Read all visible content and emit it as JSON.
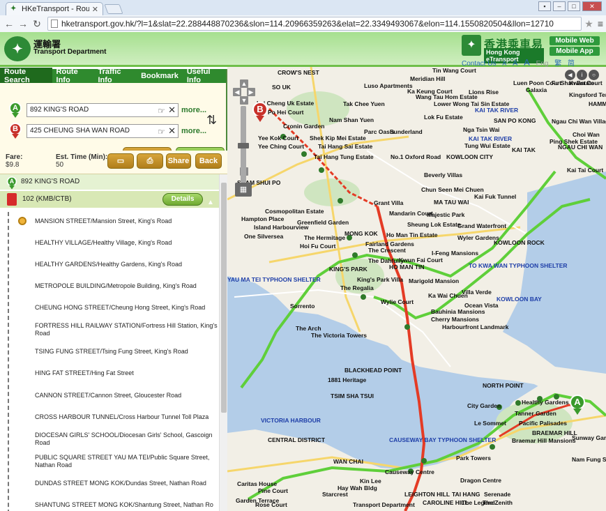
{
  "browser": {
    "tab_title": "HKeTransport - Route Se",
    "url": "hketransport.gov.hk/?l=1&slat=22.288448870236&slon=114.20966359263&elat=22.3349493067&elon=114.1550820504&llon=12710"
  },
  "header": {
    "dept_cn": "運輸署",
    "dept_en": "Transport Department",
    "brand_cn": "香港乘車易",
    "brand_en": "Hong Kong eTransport",
    "mobile_web": "Mobile Web",
    "mobile_app": "Mobile App",
    "contact": "Contact Us",
    "font_small": "A",
    "font_mid": "A",
    "font_large": "A",
    "lang_en": "Eng",
    "lang_tc": "繁",
    "lang_sc": "简"
  },
  "panel": {
    "tabs": [
      "Route Search",
      "Route Info",
      "Traffic Info",
      "Bookmark",
      "Useful Info"
    ],
    "origin": "892 KING'S ROAD",
    "destination": "425 CHEUNG SHA WAN ROAD",
    "more": "more...",
    "reset": "Reset",
    "search": "Search",
    "fare_label": "Fare:",
    "fare_value": "$9.8",
    "time_label": "Est. Time (Min):",
    "time_value": "50",
    "share": "Share",
    "back": "Back",
    "from_stop": "892 KING'S ROAD",
    "route": "102 (KMB/CTB)",
    "details": "Details",
    "stops": [
      "MANSION STREET/Mansion Street, King's Road",
      "HEALTHY VILLAGE/Healthy Village, King's Road",
      "HEALTHY GARDENS/Healthy Gardens, King's Road",
      "METROPOLE BUILDING/Metropole Building, King's Road",
      "CHEUNG HONG STREET/Cheung Hong Street, King's Road",
      "FORTRESS HILL RAILWAY STATION/Fortress Hill Station, King's Road",
      "TSING FUNG STREET/Tsing Fung Street, King's Road",
      "HING FAT STREET/Hing Fat Street",
      "CANNON STREET/Cannon Street, Gloucester Road",
      "CROSS HARBOUR TUNNEL/Cross Harbour Tunnel Toll Plaza",
      "DIOCESAN GIRLS' SCHOOL/Diocesan Girls' School, Gascoign Road",
      "PUBLIC SQUARE STREET YAU MA TEI/Public Square Street, Nathan Road",
      "DUNDAS STREET MONG KOK/Dundas Street, Nathan Road",
      "SHANTUNG STREET MONG KOK/Shantung Street, Nathan Ro"
    ]
  },
  "map": {
    "pin_a": "A",
    "pin_b": "B",
    "labels": [
      {
        "t": "CROW'S NEST",
        "c": "dark"
      },
      {
        "t": "Meridian Hill",
        "c": "dark"
      },
      {
        "t": "Tin Wang Court",
        "c": "dark"
      },
      {
        "t": "SO UK",
        "c": "dark"
      },
      {
        "t": "Luso Apartments",
        "c": "dark"
      },
      {
        "t": "Ka Keung Court",
        "c": "dark"
      },
      {
        "t": "Wang Tau Hom Estate",
        "c": "dark"
      },
      {
        "t": "Lok Fu Estate",
        "c": "dark"
      },
      {
        "t": "Lower Wong Tai Sin Estate",
        "c": "dark"
      },
      {
        "t": "Luen Poon Court",
        "c": "dark"
      },
      {
        "t": "Lions Rise",
        "c": "dark"
      },
      {
        "t": "Galaxia",
        "c": "dark"
      },
      {
        "t": "Fu Shan Estate",
        "c": "dark"
      },
      {
        "t": "Kwan Court",
        "c": "dark"
      },
      {
        "t": "Kingsford Terrace",
        "c": "dark"
      },
      {
        "t": "HAMMER HILL",
        "c": "dark"
      },
      {
        "t": "Lei Cheng Uk Estate",
        "c": "dark"
      },
      {
        "t": "Tak Chee Yuen",
        "c": "dark"
      },
      {
        "t": "Po Hei Court",
        "c": "dark"
      },
      {
        "t": "KAI TAK RIVER",
        "c": "blue"
      },
      {
        "t": "Nam Shan Yuen",
        "c": "dark"
      },
      {
        "t": "Cronin Garden",
        "c": "dark"
      },
      {
        "t": "Parc Oasis",
        "c": "dark"
      },
      {
        "t": "Sunderland",
        "c": "dark"
      },
      {
        "t": "SAN PO KONG",
        "c": "dark"
      },
      {
        "t": "Ngau Chi Wan Village",
        "c": "dark"
      },
      {
        "t": "Nga Tsin Wai",
        "c": "dark"
      },
      {
        "t": "Yee Kok Court",
        "c": "dark"
      },
      {
        "t": "Shek Kip Mei Estate",
        "c": "dark"
      },
      {
        "t": "Yee Ching Court",
        "c": "dark"
      },
      {
        "t": "Tai Hang Sai Estate",
        "c": "dark"
      },
      {
        "t": "KAI TAK RIVER",
        "c": "blue"
      },
      {
        "t": "Tung Wui Estate",
        "c": "dark"
      },
      {
        "t": "KAI TAK",
        "c": "dark"
      },
      {
        "t": "Choi Wan",
        "c": "dark"
      },
      {
        "t": "Ping Shek Estate",
        "c": "dark"
      },
      {
        "t": "NGAU CHI WAN",
        "c": "dark"
      },
      {
        "t": "Tai Hang Tung Estate",
        "c": "dark"
      },
      {
        "t": "No.1 Oxford Road",
        "c": "dark"
      },
      {
        "t": "KOWLOON CITY",
        "c": "dark"
      },
      {
        "t": "Kai Tai Court",
        "c": "dark"
      },
      {
        "t": "Beverly Villas",
        "c": "dark"
      },
      {
        "t": "SHAM SHUI PO",
        "c": "dark"
      },
      {
        "t": "Chun Seen Mei Chuen",
        "c": "dark"
      },
      {
        "t": "MA TAU WAI",
        "c": "dark"
      },
      {
        "t": "Kai Fuk Tunnel",
        "c": "dark"
      },
      {
        "t": "Grant Villa",
        "c": "dark"
      },
      {
        "t": "Cosmopolitan Estate",
        "c": "dark"
      },
      {
        "t": "Hampton Place",
        "c": "dark"
      },
      {
        "t": "Greenfield Garden",
        "c": "dark"
      },
      {
        "t": "Mandarin Court",
        "c": "dark"
      },
      {
        "t": "Majestic Park",
        "c": "dark"
      },
      {
        "t": "Sheung Lok Estate",
        "c": "dark"
      },
      {
        "t": "Island Harbourview",
        "c": "dark"
      },
      {
        "t": "Grand Waterfront",
        "c": "dark"
      },
      {
        "t": "One Silversea",
        "c": "dark"
      },
      {
        "t": "MONG KOK",
        "c": "dark"
      },
      {
        "t": "Ho Man Tin Estate",
        "c": "dark"
      },
      {
        "t": "The Hermitage",
        "c": "dark"
      },
      {
        "t": "Wyler Gardens",
        "c": "dark"
      },
      {
        "t": "Fairland Gardens",
        "c": "dark"
      },
      {
        "t": "Hoi Fu Court",
        "c": "dark"
      },
      {
        "t": "The Crescent",
        "c": "dark"
      },
      {
        "t": "KOWLOON ROCK",
        "c": "dark"
      },
      {
        "t": "I-Feng Mansions",
        "c": "dark"
      },
      {
        "t": "The Dahfully",
        "c": "dark"
      },
      {
        "t": "Kwun Fai Court",
        "c": "dark"
      },
      {
        "t": "TO KWA WAN TYPHOON SHELTER",
        "c": "blue"
      },
      {
        "t": "KING'S PARK",
        "c": "dark"
      },
      {
        "t": "HO MAN TIN",
        "c": "dark"
      },
      {
        "t": "YAU MA TEI TYPHOON SHELTER",
        "c": "blue"
      },
      {
        "t": "King's Park Villa",
        "c": "dark"
      },
      {
        "t": "Marigold Mansion",
        "c": "dark"
      },
      {
        "t": "The Regalia",
        "c": "dark"
      },
      {
        "t": "Villa Verde",
        "c": "dark"
      },
      {
        "t": "Ka Wai Chuen",
        "c": "dark"
      },
      {
        "t": "KOWLOON BAY",
        "c": "blue"
      },
      {
        "t": "Wylie Court",
        "c": "dark"
      },
      {
        "t": "Ocean Vista",
        "c": "dark"
      },
      {
        "t": "Sorrento",
        "c": "dark"
      },
      {
        "t": "Bauhinia Mansions",
        "c": "dark"
      },
      {
        "t": "Cherry Mansions",
        "c": "dark"
      },
      {
        "t": "Harbourfront Landmark",
        "c": "dark"
      },
      {
        "t": "The Arch",
        "c": "dark"
      },
      {
        "t": "The Victoria Towers",
        "c": "dark"
      },
      {
        "t": "BLACKHEAD POINT",
        "c": "dark"
      },
      {
        "t": "1881 Heritage",
        "c": "dark"
      },
      {
        "t": "TSIM SHA TSUI",
        "c": "dark"
      },
      {
        "t": "NORTH POINT",
        "c": "dark"
      },
      {
        "t": "City Garden",
        "c": "dark"
      },
      {
        "t": "Healthy Gardens",
        "c": "dark"
      },
      {
        "t": "Tanner Garden",
        "c": "dark"
      },
      {
        "t": "VICTORIA HARBOUR",
        "c": "blue"
      },
      {
        "t": "Le Sommet",
        "c": "dark"
      },
      {
        "t": "Pacific Palisades",
        "c": "dark"
      },
      {
        "t": "BRAEMAR HILL",
        "c": "dark"
      },
      {
        "t": "CENTRAL DISTRICT",
        "c": "dark"
      },
      {
        "t": "CAUSEWAY BAY TYPHOON SHELTER",
        "c": "blue"
      },
      {
        "t": "Braemar Hill Mansions",
        "c": "dark"
      },
      {
        "t": "Sunway Garden",
        "c": "dark"
      },
      {
        "t": "Park Towers",
        "c": "dark"
      },
      {
        "t": "Nam Fung Sun",
        "c": "dark"
      },
      {
        "t": "WAN CHAI",
        "c": "dark"
      },
      {
        "t": "Causeway Centre",
        "c": "dark"
      },
      {
        "t": "Dragon Centre",
        "c": "dark"
      },
      {
        "t": "Caritas House",
        "c": "dark"
      },
      {
        "t": "Kin Lee",
        "c": "dark"
      },
      {
        "t": "Hay Wah Bldg",
        "c": "dark"
      },
      {
        "t": "Pine Court",
        "c": "dark"
      },
      {
        "t": "Starcrest",
        "c": "dark"
      },
      {
        "t": "LEIGHTON HILL",
        "c": "dark"
      },
      {
        "t": "TAI HANG",
        "c": "dark"
      },
      {
        "t": "Serenade",
        "c": "dark"
      },
      {
        "t": "Garden Terrace",
        "c": "dark"
      },
      {
        "t": "CAROLINE HILL",
        "c": "dark"
      },
      {
        "t": "The Legend",
        "c": "dark"
      },
      {
        "t": "The Zenith",
        "c": "dark"
      },
      {
        "t": "Rose Court",
        "c": "dark"
      },
      {
        "t": "Transport Department",
        "c": "dark"
      }
    ]
  }
}
